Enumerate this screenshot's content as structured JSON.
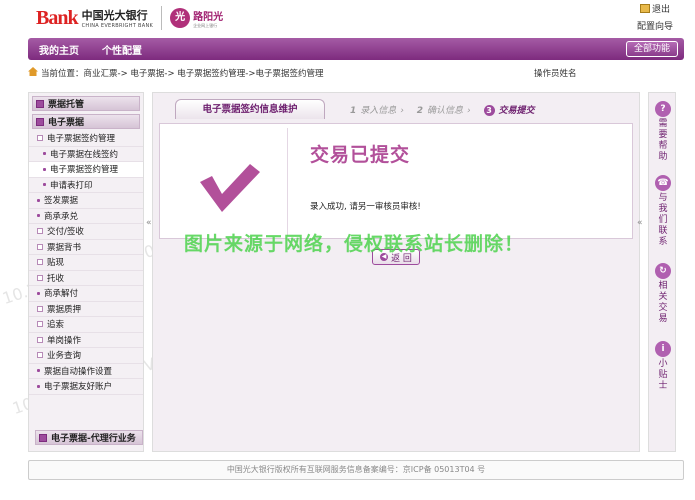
{
  "brand": {
    "logo_text": "Bank",
    "bank_name_cn": "中国光大银行",
    "bank_name_en": "CHINA EVERBRIGHT BANK",
    "cert_seal": "光",
    "cert_name": "路阳光",
    "cert_sub": "企业网上银行"
  },
  "header": {
    "exit_label": "退出",
    "guide_label": "配置向导"
  },
  "nav": {
    "home": "我的主页",
    "personal": "个性配置",
    "all_functions": "全部功能"
  },
  "location": {
    "prefix": "当前位置：",
    "path": "商业汇票-> 电子票据-> 电子票据签约管理->电子票据签约管理",
    "operator": "操作员姓名"
  },
  "sidebar": {
    "heads": [
      "票据托管",
      "电子票据",
      "电子票据-代理行业务"
    ],
    "items": [
      {
        "label": "电子票据签约管理",
        "type": "sub"
      },
      {
        "label": "电子票据在线签约",
        "type": "child"
      },
      {
        "label": "电子票据签约管理",
        "type": "child",
        "active": true
      },
      {
        "label": "申请表打印",
        "type": "child"
      },
      {
        "label": "签发票据",
        "type": "dot"
      },
      {
        "label": "商承承兑",
        "type": "dot"
      },
      {
        "label": "交付/签收",
        "type": "sub"
      },
      {
        "label": "票据背书",
        "type": "sub"
      },
      {
        "label": "贴现",
        "type": "sub"
      },
      {
        "label": "托收",
        "type": "sub"
      },
      {
        "label": "商承解付",
        "type": "dot"
      },
      {
        "label": "票据质押",
        "type": "sub"
      },
      {
        "label": "追索",
        "type": "sub"
      },
      {
        "label": "单岗操作",
        "type": "sub"
      },
      {
        "label": "业务查询",
        "type": "sub"
      },
      {
        "label": "票据自动操作设置",
        "type": "dot"
      },
      {
        "label": "电子票据友好账户",
        "type": "dot"
      }
    ]
  },
  "main": {
    "tab_title": "电子票据签约信息维护",
    "steps": [
      {
        "num": "1",
        "label": "录入信息"
      },
      {
        "num": "2",
        "label": "确认信息"
      },
      {
        "num": "3",
        "label": "交易提交"
      }
    ],
    "done_title": "交易已提交",
    "message": "录入成功, 请另一审核员审核!",
    "back_label": "返 回"
  },
  "rail": [
    {
      "icon": "?",
      "label": "需要帮助"
    },
    {
      "icon": "☎",
      "label": "与我们联系"
    },
    {
      "icon": "↻",
      "label": "相关交易"
    },
    {
      "icon": "i",
      "label": "小贴士"
    }
  ],
  "footer": "中国光大银行版权所有互联网服务信息备案编号：京ICP备 05013T04 号",
  "overlay_text": "图片来源于网络，侵权联系站长删除！",
  "watermark": "10.200.15.2 W76V0015T04-004",
  "colors": {
    "brand_purple": "#7d2b7e",
    "check_purple": "#b2509a",
    "overlay_green": "#4cd24c"
  }
}
